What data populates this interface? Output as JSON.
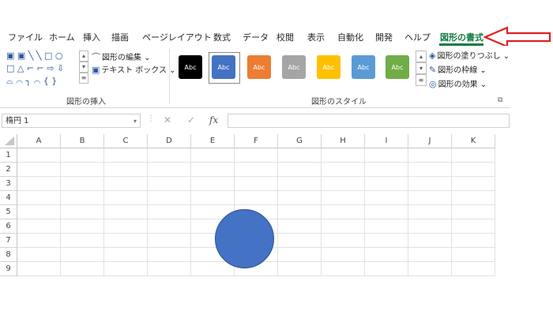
{
  "tabs": [
    "ファイル",
    "ホーム",
    "挿入",
    "描画",
    "ページレイアウト",
    "数式",
    "データ",
    "校閲",
    "表示",
    "自動化",
    "開発",
    "ヘルプ",
    "図形の書式"
  ],
  "active_tab": "図形の書式",
  "colors": {
    "accent": "#107c41",
    "arrow": "#e02020",
    "shape_fill": "#4472c4"
  },
  "insert_shapes": {
    "row1": "▣ ▣ ╲ ╲ □ ○",
    "row2": "□ △ ⌐ ⌐ ⇨ ⇩",
    "row3": "⌓ ⌒ ╮ ⌒ { }",
    "edit_shape": "図形の編集 ⌄",
    "text_box": "テキスト ボックス ⌄",
    "group_label": "図形の挿入"
  },
  "shape_styles": {
    "swatches": [
      {
        "label": "Abc",
        "color": "#000000"
      },
      {
        "label": "Abc",
        "color": "#4472c4"
      },
      {
        "label": "Abc",
        "color": "#ed7d31"
      },
      {
        "label": "Abc",
        "color": "#a5a5a5"
      },
      {
        "label": "Abc",
        "color": "#ffc000"
      },
      {
        "label": "Abc",
        "color": "#5b9bd5"
      },
      {
        "label": "Abc",
        "color": "#70ad47"
      }
    ],
    "fill": "図形の塗りつぶし ⌄",
    "outline": "図形の枠線 ⌄",
    "effects": "図形の効果 ⌄",
    "group_label": "図形のスタイル"
  },
  "formula_bar": {
    "name_box": "楕円 1",
    "cancel": "✕",
    "enter": "✓",
    "fx": "fx",
    "content": ""
  },
  "columns": [
    "A",
    "B",
    "C",
    "D",
    "E",
    "F",
    "G",
    "H",
    "I",
    "J",
    "K"
  ],
  "rows": [
    "1",
    "2",
    "3",
    "4",
    "5",
    "6",
    "7",
    "8",
    "9"
  ]
}
